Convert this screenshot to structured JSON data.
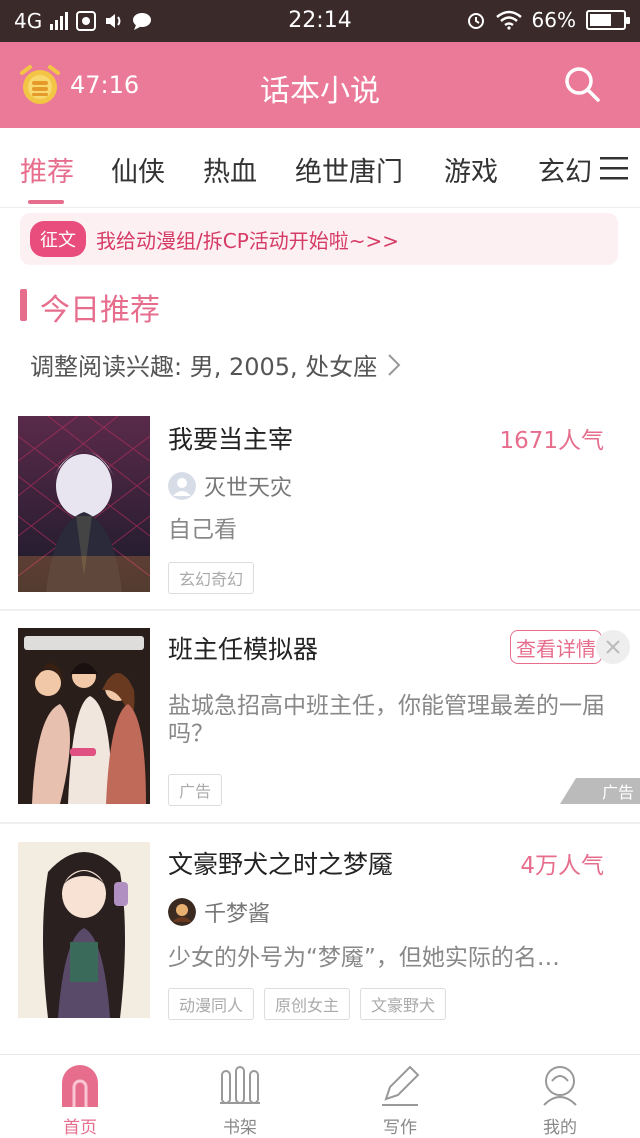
{
  "status_bar": {
    "network": "4G",
    "time": "22:14",
    "battery": "66%",
    "battery_level": 0.66
  },
  "header": {
    "timer": "47:16",
    "title": "话本小说"
  },
  "tabs": [
    {
      "label": "推荐",
      "active": true
    },
    {
      "label": "仙侠"
    },
    {
      "label": "热血"
    },
    {
      "label": "绝世唐门"
    },
    {
      "label": "游戏"
    },
    {
      "label": "玄幻"
    }
  ],
  "banner": {
    "badge": "征文",
    "text": "我给动漫组/拆CP活动开始啦~>>"
  },
  "section": {
    "title": "今日推荐",
    "preference": "调整阅读兴趣: 男, 2005, 处女座"
  },
  "books": [
    {
      "title": "我要当主宰",
      "popularity": "1671人气",
      "author": "灭世天灾",
      "desc": "自己看",
      "tags": [
        "玄幻奇幻"
      ]
    },
    {
      "title": "班主任模拟器",
      "action": "查看详情",
      "desc": "盐城急招高中班主任，你能管理最差的一届吗？",
      "tags": [
        "广告"
      ],
      "ad_label": "广告"
    },
    {
      "title": "文豪野犬之时之梦魇",
      "popularity": "4万人气",
      "author": "千梦酱",
      "desc": "少女的外号为“梦魇”，但她实际的名…",
      "tags": [
        "动漫同人",
        "原创女主",
        "文豪野犬"
      ]
    }
  ],
  "bottom_nav": [
    {
      "label": "首页",
      "active": true
    },
    {
      "label": "书架"
    },
    {
      "label": "写作"
    },
    {
      "label": "我的"
    }
  ],
  "colors": {
    "accent": "#e76d8d",
    "header_bg": "#eb7a98",
    "status_bg": "#3a2a2a"
  }
}
